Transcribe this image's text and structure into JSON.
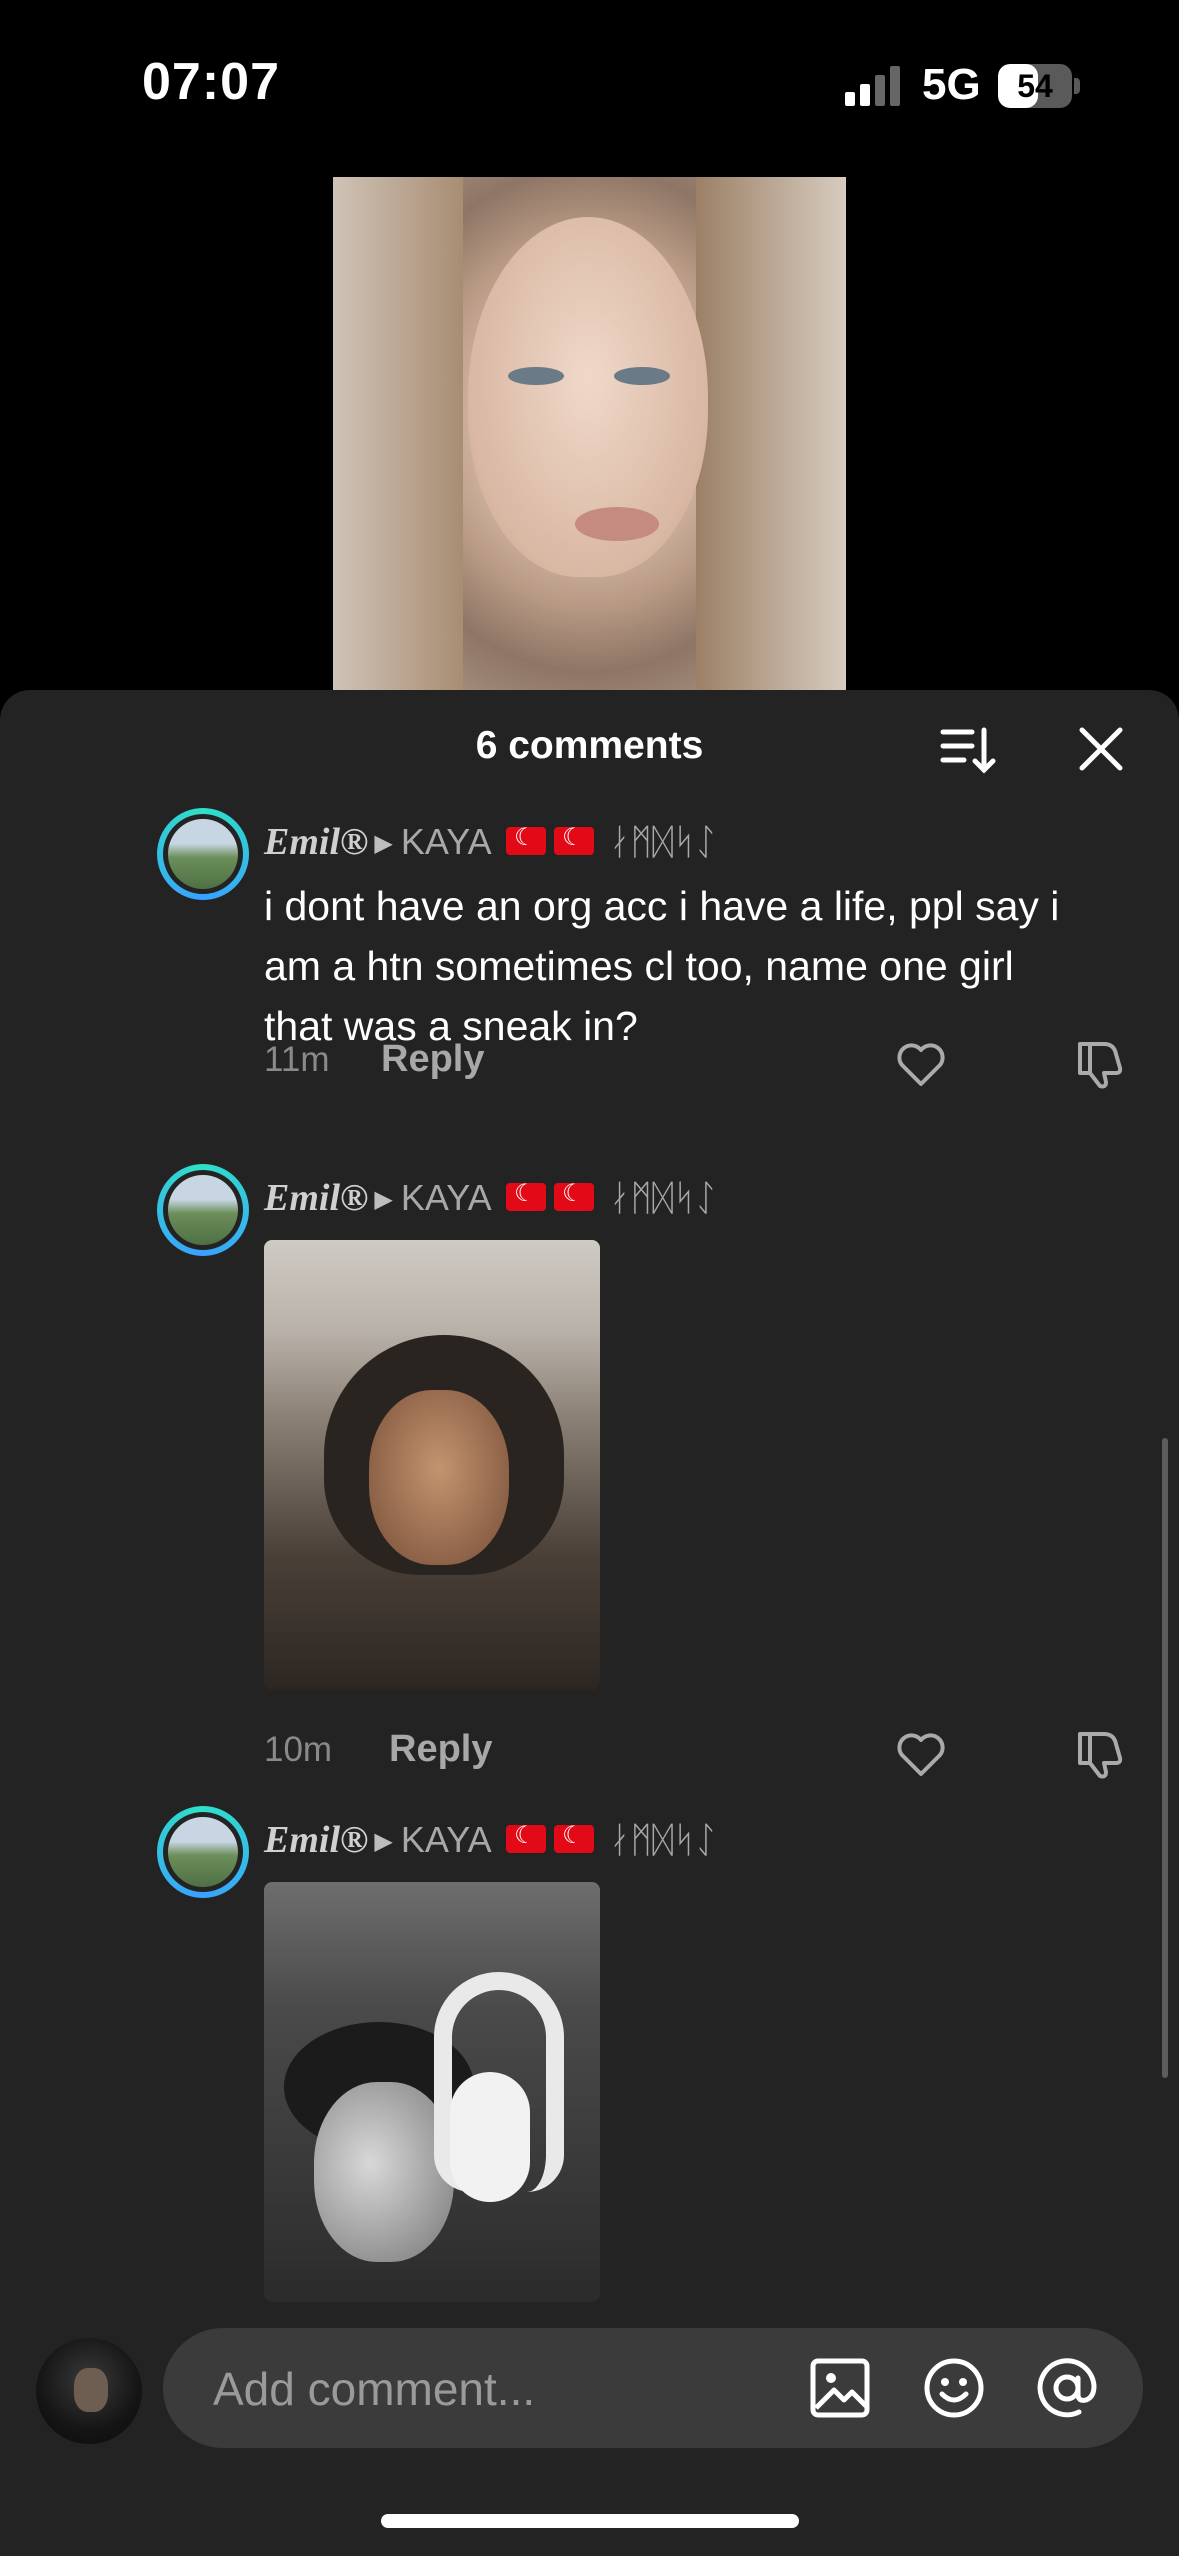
{
  "status": {
    "time": "07:07",
    "network": "5G",
    "battery": "54",
    "battery_level": 0.54
  },
  "header": {
    "title": "6 comments"
  },
  "comments": [
    {
      "name": "Emil®",
      "tag": "KAYA",
      "glyphs": "ᛅᛗᛞᛋᛇ",
      "text": "i dont have an org acc i have a life, ppl say i am a htn sometimes cl too, name one girl that was a sneak in?",
      "time": "11m",
      "reply": "Reply"
    },
    {
      "name": "Emil®",
      "tag": "KAYA",
      "glyphs": "ᛅᛗᛞᛋᛇ",
      "time": "10m",
      "reply": "Reply"
    },
    {
      "name": "Emil®",
      "tag": "KAYA",
      "glyphs": "ᛅᛗᛞᛋᛇ"
    }
  ],
  "composer": {
    "placeholder": "Add comment..."
  }
}
